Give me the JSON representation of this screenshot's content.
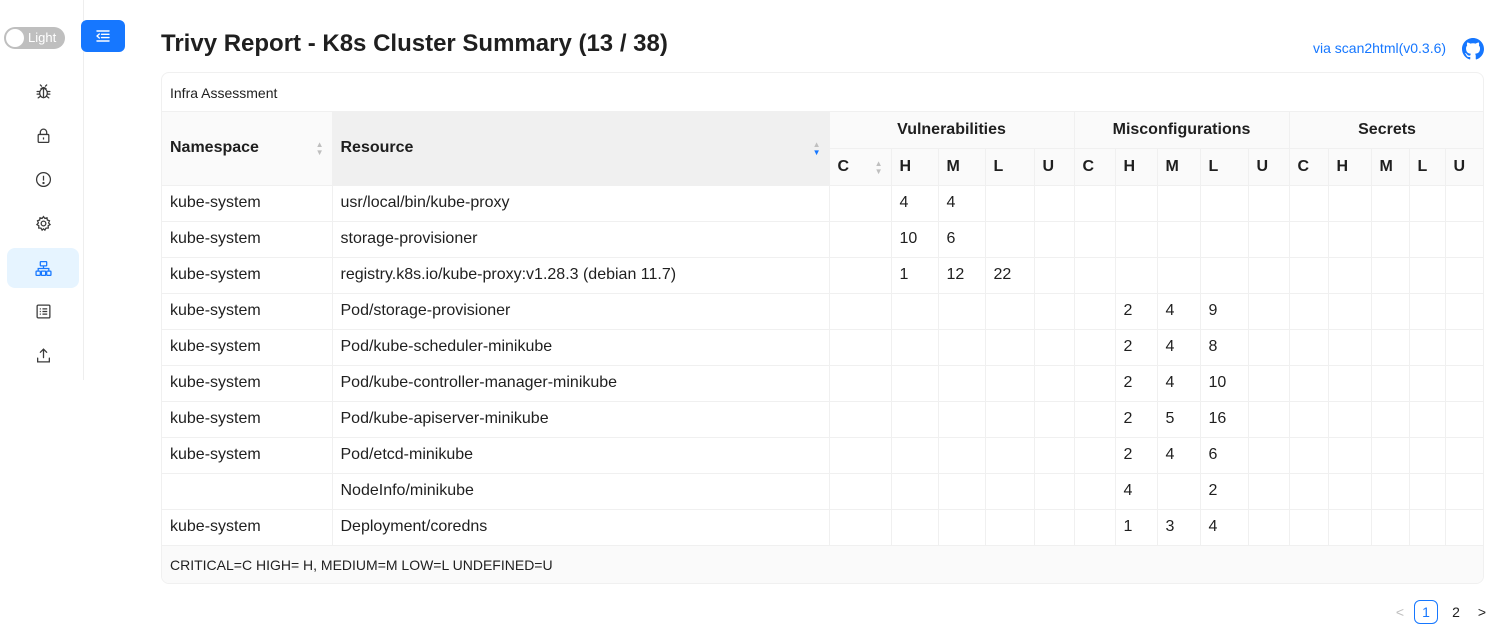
{
  "theme_toggle": {
    "label": "Light"
  },
  "header": {
    "title": "Trivy Report - K8s Cluster Summary (13 / 38)",
    "via_link": "via scan2html(v0.3.6)"
  },
  "sidebar": {
    "items": [
      {
        "icon": "bug-icon"
      },
      {
        "icon": "lock-icon"
      },
      {
        "icon": "alert-circle-icon"
      },
      {
        "icon": "gear-icon"
      },
      {
        "icon": "cluster-icon",
        "selected": true
      },
      {
        "icon": "list-icon"
      },
      {
        "icon": "upload-icon"
      }
    ]
  },
  "table": {
    "caption": "Infra Assessment",
    "columns": {
      "namespace": "Namespace",
      "resource": "Resource",
      "vulnerabilities": "Vulnerabilities",
      "misconfigurations": "Misconfigurations",
      "secrets": "Secrets",
      "c": "C",
      "h": "H",
      "m": "M",
      "l": "L",
      "u": "U"
    },
    "rows": [
      {
        "namespace": "kube-system",
        "resource": "usr/local/bin/kube-proxy",
        "v": [
          "",
          "4",
          "4",
          "",
          ""
        ],
        "mc": [
          "",
          "",
          "",
          "",
          ""
        ],
        "s": [
          "",
          "",
          "",
          "",
          ""
        ]
      },
      {
        "namespace": "kube-system",
        "resource": "storage-provisioner",
        "v": [
          "",
          "10",
          "6",
          "",
          ""
        ],
        "mc": [
          "",
          "",
          "",
          "",
          ""
        ],
        "s": [
          "",
          "",
          "",
          "",
          ""
        ]
      },
      {
        "namespace": "kube-system",
        "resource": "registry.k8s.io/kube-proxy:v1.28.3 (debian 11.7)",
        "v": [
          "",
          "1",
          "12",
          "22",
          ""
        ],
        "mc": [
          "",
          "",
          "",
          "",
          ""
        ],
        "s": [
          "",
          "",
          "",
          "",
          ""
        ]
      },
      {
        "namespace": "kube-system",
        "resource": "Pod/storage-provisioner",
        "v": [
          "",
          "",
          "",
          "",
          ""
        ],
        "mc": [
          "",
          "2",
          "4",
          "9",
          ""
        ],
        "s": [
          "",
          "",
          "",
          "",
          ""
        ]
      },
      {
        "namespace": "kube-system",
        "resource": "Pod/kube-scheduler-minikube",
        "v": [
          "",
          "",
          "",
          "",
          ""
        ],
        "mc": [
          "",
          "2",
          "4",
          "8",
          ""
        ],
        "s": [
          "",
          "",
          "",
          "",
          ""
        ]
      },
      {
        "namespace": "kube-system",
        "resource": "Pod/kube-controller-manager-minikube",
        "v": [
          "",
          "",
          "",
          "",
          ""
        ],
        "mc": [
          "",
          "2",
          "4",
          "10",
          ""
        ],
        "s": [
          "",
          "",
          "",
          "",
          ""
        ]
      },
      {
        "namespace": "kube-system",
        "resource": "Pod/kube-apiserver-minikube",
        "v": [
          "",
          "",
          "",
          "",
          ""
        ],
        "mc": [
          "",
          "2",
          "5",
          "16",
          ""
        ],
        "s": [
          "",
          "",
          "",
          "",
          ""
        ]
      },
      {
        "namespace": "kube-system",
        "resource": "Pod/etcd-minikube",
        "v": [
          "",
          "",
          "",
          "",
          ""
        ],
        "mc": [
          "",
          "2",
          "4",
          "6",
          ""
        ],
        "s": [
          "",
          "",
          "",
          "",
          ""
        ]
      },
      {
        "namespace": "",
        "resource": "NodeInfo/minikube",
        "v": [
          "",
          "",
          "",
          "",
          ""
        ],
        "mc": [
          "",
          "4",
          "",
          "2",
          ""
        ],
        "s": [
          "",
          "",
          "",
          "",
          ""
        ]
      },
      {
        "namespace": "kube-system",
        "resource": "Deployment/coredns",
        "v": [
          "",
          "",
          "",
          "",
          ""
        ],
        "mc": [
          "",
          "1",
          "3",
          "4",
          ""
        ],
        "s": [
          "",
          "",
          "",
          "",
          ""
        ]
      }
    ],
    "footer": "CRITICAL=C HIGH= H, MEDIUM=M LOW=L UNDEFINED=U"
  },
  "pagination": {
    "prev": "<",
    "next": ">",
    "pages": [
      "1",
      "2"
    ],
    "current": "1"
  },
  "colors": {
    "accent": "#1677ff",
    "selected_bg": "#e6f4ff",
    "header_bg": "#fafafa",
    "border": "#f0f0f0"
  }
}
